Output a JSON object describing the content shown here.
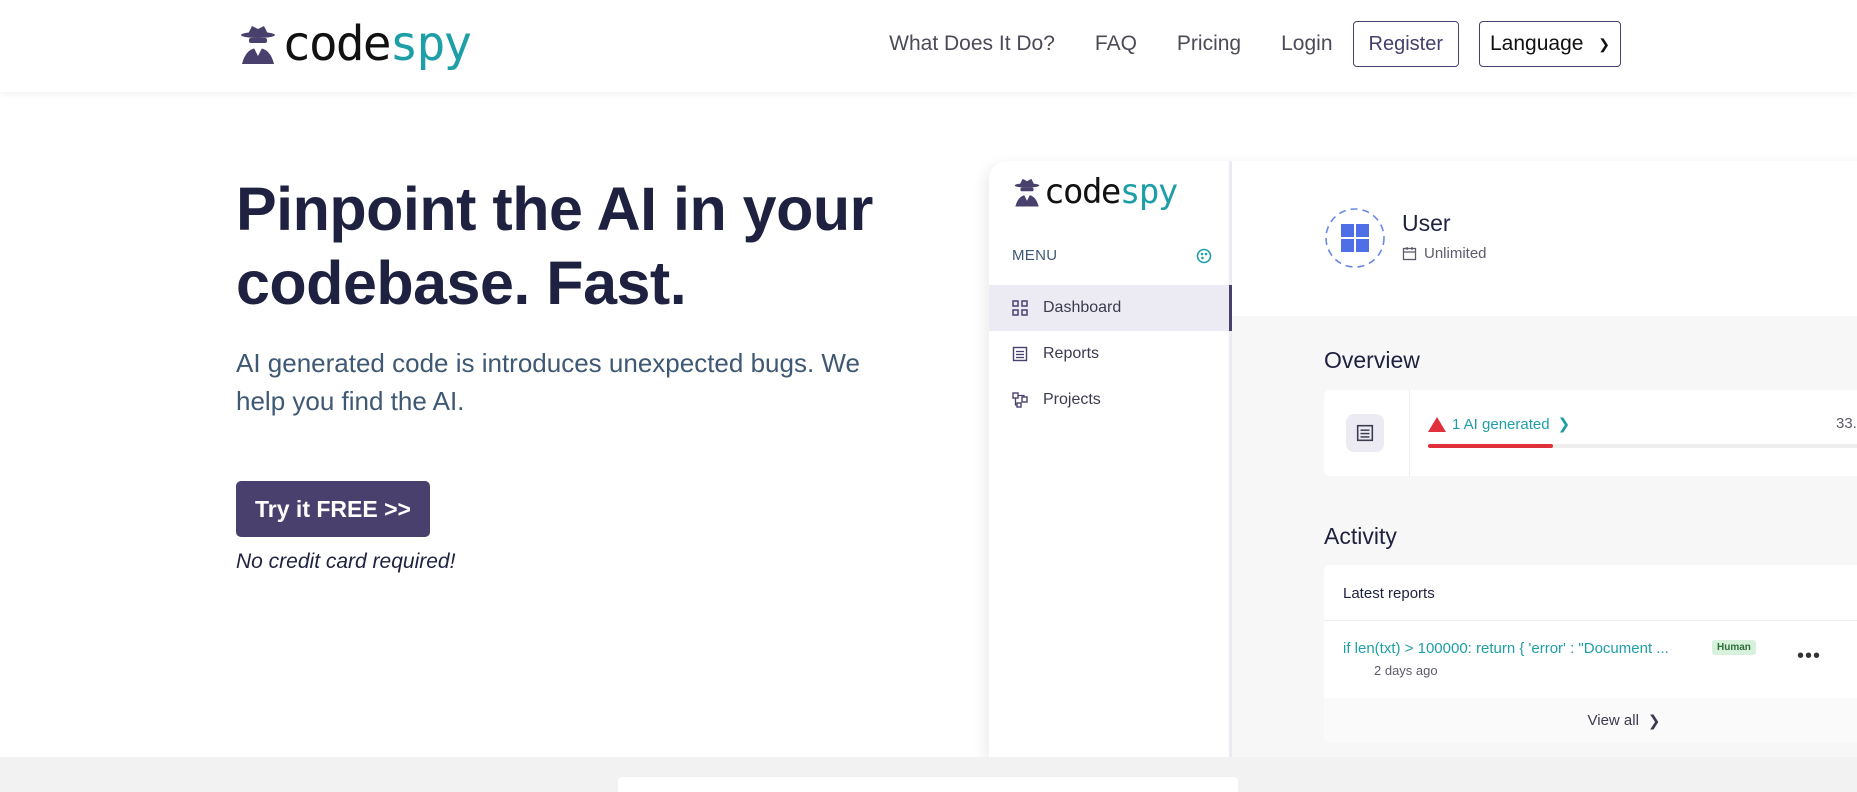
{
  "brand": {
    "logo_part1": "code",
    "logo_part2": "spy"
  },
  "nav": {
    "links": [
      "What Does It Do?",
      "FAQ",
      "Pricing",
      "Login"
    ],
    "register_label": "Register",
    "language_label": "Language"
  },
  "hero": {
    "title": "Pinpoint the AI in your codebase. Fast.",
    "subtitle": "AI generated code is introduces unexpected bugs. We help you find the AI.",
    "cta_label": "Try it FREE >>",
    "cta_note": "No credit card required!"
  },
  "mockup": {
    "menu_label": "MENU",
    "menu_items": [
      "Dashboard",
      "Reports",
      "Projects"
    ],
    "user": {
      "name": "User",
      "plan": "Unlimited"
    },
    "overview": {
      "title": "Overview",
      "ai_label": "1 AI generated",
      "percent_text": "33.",
      "progress_fraction": 0.25
    },
    "activity": {
      "title": "Activity",
      "latest_label": "Latest reports",
      "report_code": "if len(txt) > 100000: return { 'error' : \"Document ...",
      "report_badge": "Human",
      "report_time": "2 days ago",
      "view_all": "View all"
    }
  },
  "colors": {
    "primary": "#4a406e",
    "accent": "#1e9fa7",
    "alert": "#e0303b",
    "heading": "#1f2140"
  }
}
